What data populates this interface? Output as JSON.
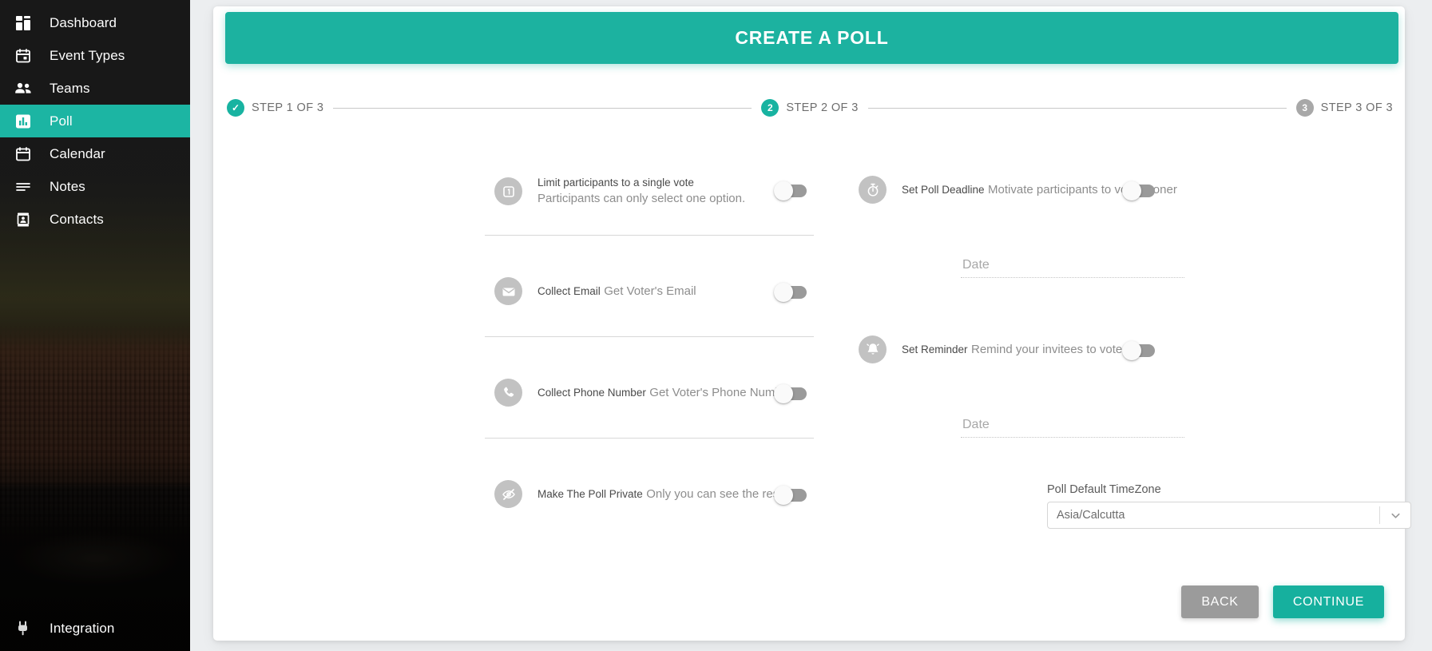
{
  "sidebar": {
    "items": [
      {
        "label": "Dashboard",
        "icon": "dashboard-icon",
        "active": false
      },
      {
        "label": "Event Types",
        "icon": "calendar-event-icon",
        "active": false
      },
      {
        "label": "Teams",
        "icon": "people-icon",
        "active": false
      },
      {
        "label": "Poll",
        "icon": "bar-chart-icon",
        "active": true
      },
      {
        "label": "Calendar",
        "icon": "calendar-icon",
        "active": false
      },
      {
        "label": "Notes",
        "icon": "lines-icon",
        "active": false
      },
      {
        "label": "Contacts",
        "icon": "contact-card-icon",
        "active": false
      }
    ],
    "footer": {
      "label": "Integration",
      "icon": "plug-icon"
    },
    "active_color": "#1cb5a3"
  },
  "banner": {
    "title": "CREATE A POLL",
    "color": "#1cb2a0"
  },
  "stepper": {
    "steps": [
      {
        "badge": "✓",
        "label": "STEP 1 OF 3",
        "state": "done"
      },
      {
        "badge": "2",
        "label": "STEP 2 OF 3",
        "state": "current"
      },
      {
        "badge": "3",
        "label": "STEP 3 OF 3",
        "state": "todo"
      }
    ],
    "done_color": "#18b3a1",
    "todo_color": "#a8a8a8"
  },
  "left_options": [
    {
      "icon": "number-one-icon",
      "title": "Limit participants to a single vote",
      "subtitle": "Participants can only select one option.",
      "toggle_state": "off"
    },
    {
      "icon": "envelope-icon",
      "title": "Collect Email",
      "subtitle": "Get Voter's Email",
      "toggle_state": "off"
    },
    {
      "icon": "phone-icon",
      "title": "Collect Phone Number",
      "subtitle": "Get Voter's Phone Number",
      "toggle_state": "off"
    },
    {
      "icon": "eye-slash-icon",
      "title": "Make The Poll Private",
      "subtitle": "Only you can see the results.",
      "toggle_state": "off"
    }
  ],
  "right_options": [
    {
      "icon": "stopwatch-icon",
      "title": "Set Poll Deadline",
      "subtitle": "Motivate participants to vote sooner",
      "toggle_state": "off"
    },
    {
      "icon": "bell-icon",
      "title": "Set Reminder",
      "subtitle": "Remind your invitees to vote.",
      "toggle_state": "off"
    }
  ],
  "deadline_date": {
    "value": "",
    "placeholder": "Date"
  },
  "reminder_date": {
    "value": "",
    "placeholder": "Date"
  },
  "timezone": {
    "label": "Poll Default TimeZone",
    "value": "Asia/Calcutta"
  },
  "actions": {
    "back_label": "BACK",
    "continue_label": "CONTINUE",
    "back_color": "#9b9b9b",
    "continue_color": "#16b09e"
  }
}
